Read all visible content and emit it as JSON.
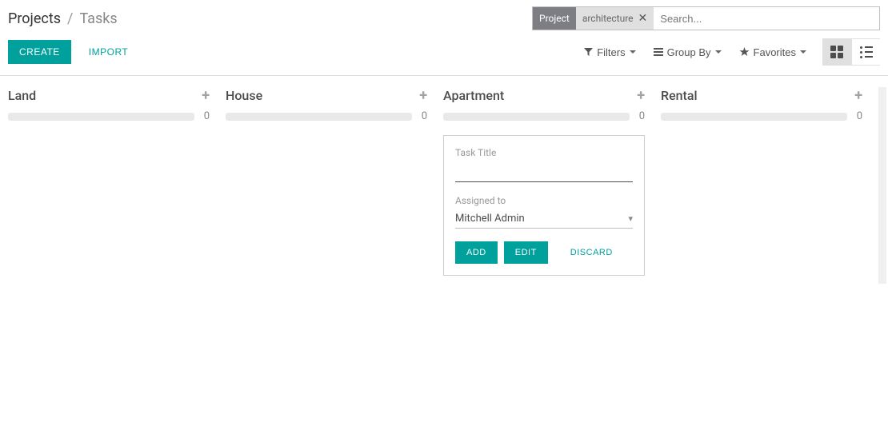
{
  "breadcrumb": {
    "root": "Projects",
    "current": "Tasks"
  },
  "search": {
    "tag_label": "Project",
    "tag_value": "architecture",
    "placeholder": "Search..."
  },
  "actions": {
    "create": "CREATE",
    "import": "IMPORT",
    "filters": "Filters",
    "group_by": "Group By",
    "favorites": "Favorites"
  },
  "columns": [
    {
      "title": "Land",
      "count": "0"
    },
    {
      "title": "House",
      "count": "0"
    },
    {
      "title": "Apartment",
      "count": "0"
    },
    {
      "title": "Rental",
      "count": "0"
    }
  ],
  "quick_create": {
    "title_label": "Task Title",
    "title_value": "",
    "assigned_label": "Assigned to",
    "assigned_value": "Mitchell Admin",
    "add": "ADD",
    "edit": "EDIT",
    "discard": "DISCARD"
  }
}
